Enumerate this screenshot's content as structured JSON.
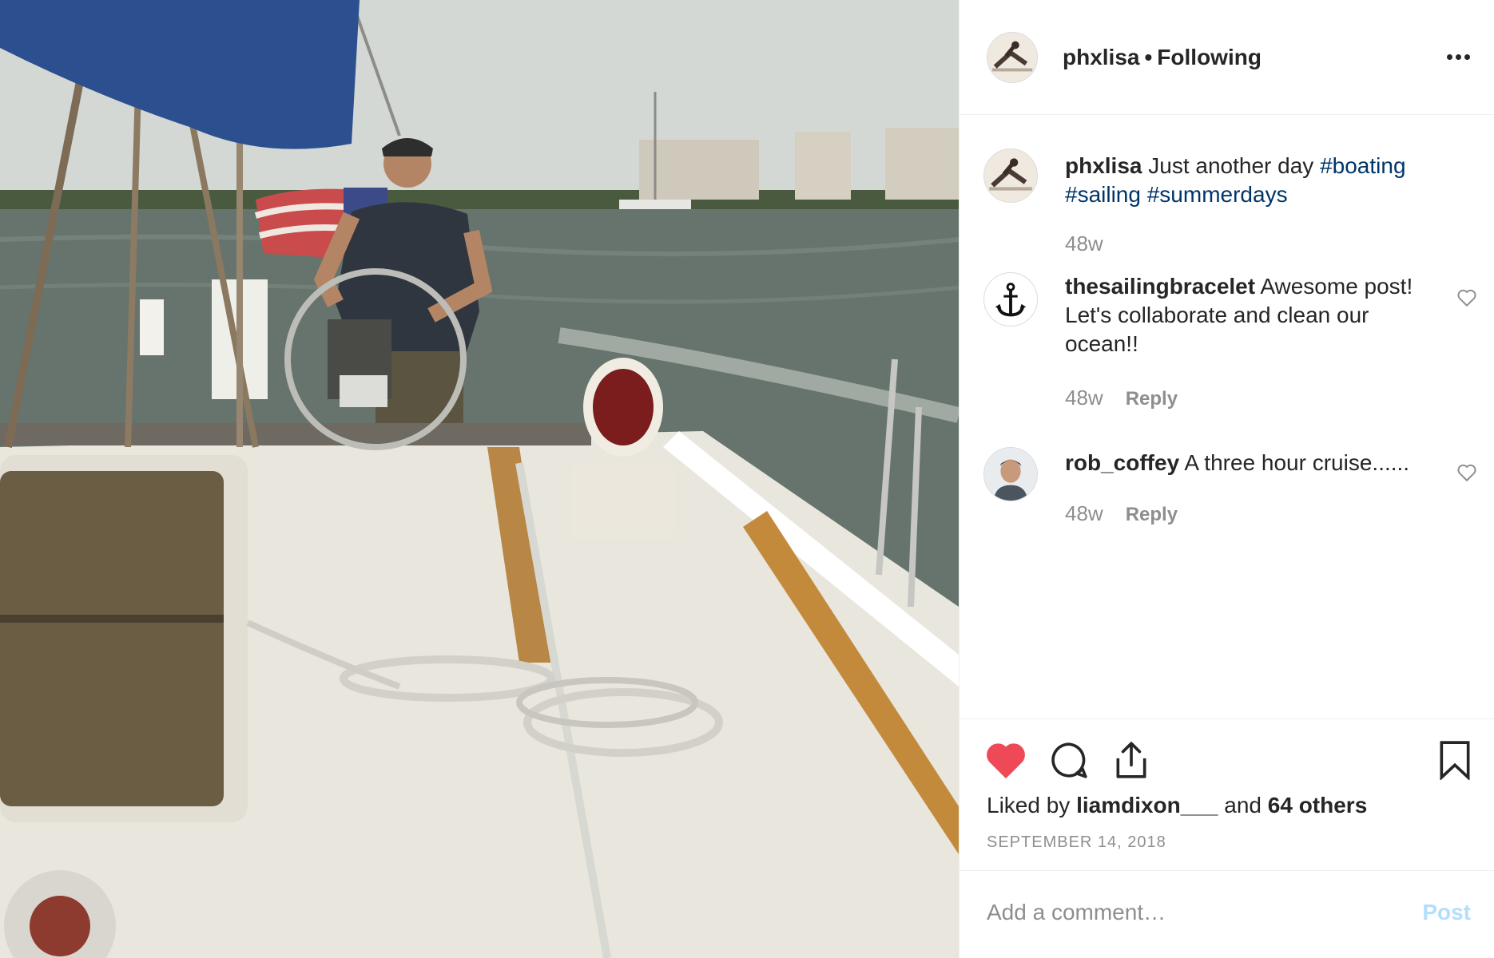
{
  "post": {
    "author": "phxlisa",
    "follow_status": "Following",
    "separator": "•"
  },
  "caption": {
    "user": "phxlisa",
    "text": "Just another day",
    "hashtags": [
      "#boating",
      "#sailing",
      "#summerdays"
    ],
    "age": "48w"
  },
  "comments": [
    {
      "user": "thesailingbracelet",
      "text": "Awesome post! Let's collaborate and clean our ocean!!",
      "age": "48w",
      "reply_label": "Reply",
      "avatar_icon": "anchor-icon"
    },
    {
      "user": "rob_coffey",
      "text": "A three hour cruise......",
      "age": "48w",
      "reply_label": "Reply",
      "avatar_icon": "profile-photo"
    }
  ],
  "actions": {
    "like_icon": "heart-filled-icon",
    "comment_icon": "comment-bubble-icon",
    "share_icon": "share-icon",
    "save_icon": "bookmark-icon"
  },
  "likes": {
    "prefix": "Liked by",
    "user": "liamdixon___",
    "joiner": "and",
    "others": "64 others"
  },
  "date": "SEPTEMBER 14, 2018",
  "add_comment": {
    "placeholder": "Add a comment…",
    "post_label": "Post"
  },
  "colors": {
    "like_red": "#ed4956",
    "hashtag": "#003569",
    "muted": "#8e8e8e",
    "post_disabled": "#b2dffc"
  }
}
